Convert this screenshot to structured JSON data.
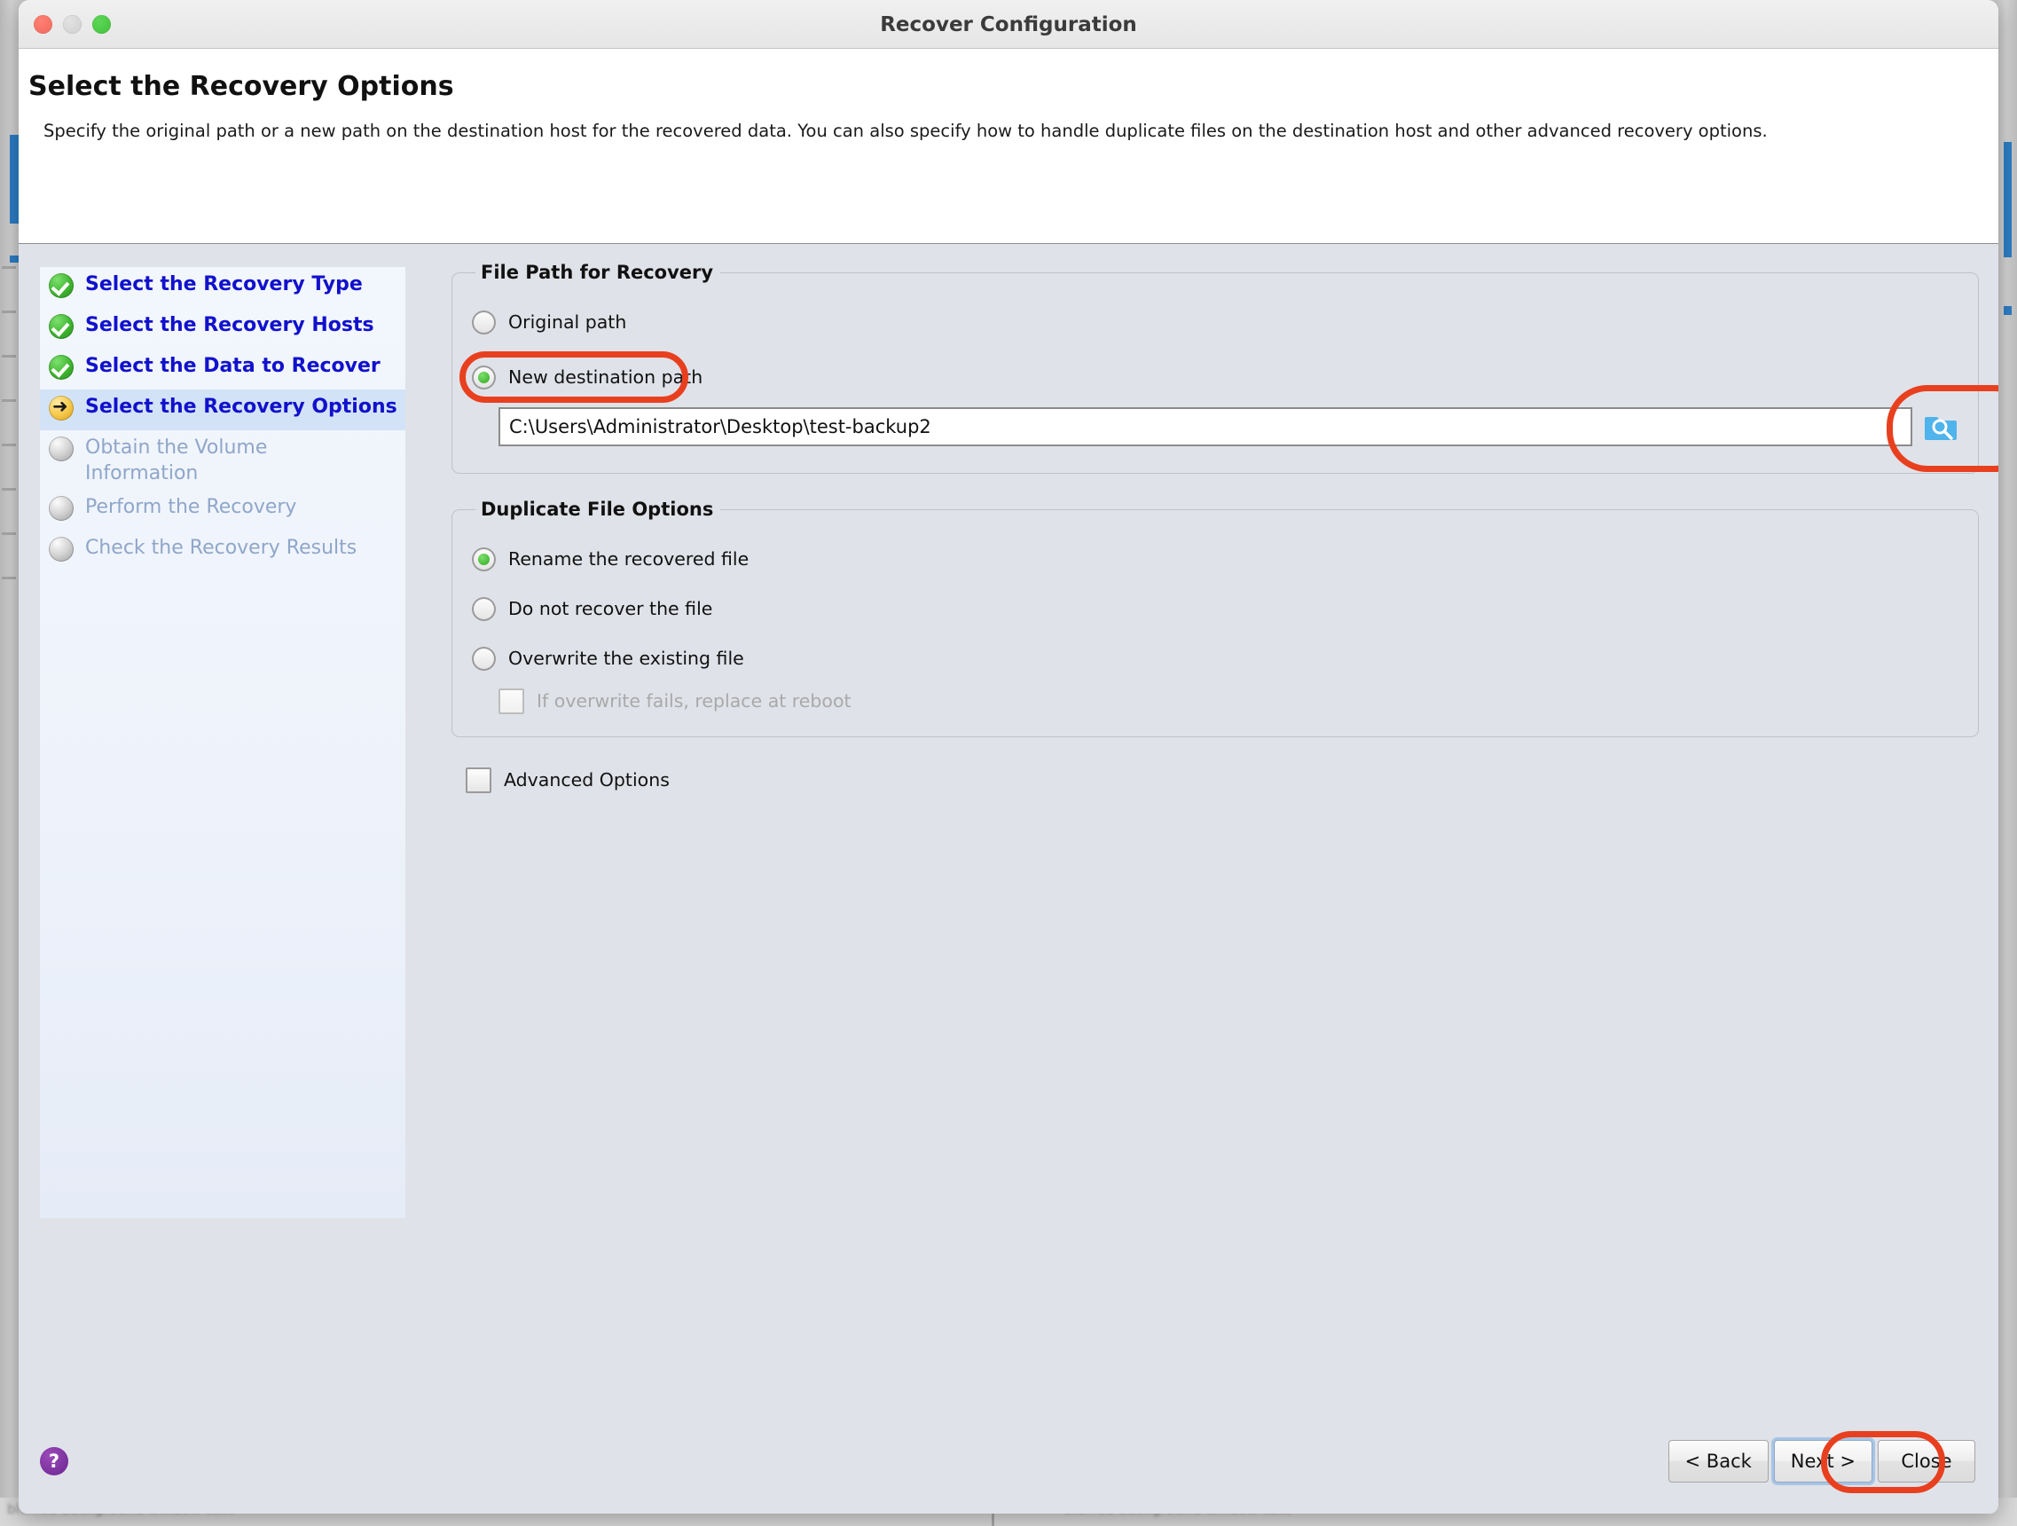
{
  "window": {
    "title": "Recover Configuration",
    "traffic_lights": [
      "close",
      "minimize",
      "maximize"
    ]
  },
  "header": {
    "page_title": "Select the Recovery Options",
    "description": "Specify the original path or a new path on the destination host for the recovered data. You can also specify how to handle duplicate files on the destination host and other advanced recovery options."
  },
  "sidebar": {
    "items": [
      {
        "label": "Select the Recovery Type",
        "state": "done"
      },
      {
        "label": "Select the Recovery Hosts",
        "state": "done"
      },
      {
        "label": "Select the Data to Recover",
        "state": "done"
      },
      {
        "label": "Select the Recovery Options",
        "state": "current"
      },
      {
        "label": "Obtain the Volume Information",
        "state": "pending"
      },
      {
        "label": "Perform the Recovery",
        "state": "pending"
      },
      {
        "label": "Check the Recovery Results",
        "state": "pending"
      }
    ]
  },
  "file_path_group": {
    "legend": "File Path for Recovery",
    "options": [
      {
        "label": "Original path",
        "checked": false
      },
      {
        "label": "New destination path",
        "checked": true
      }
    ],
    "path_value": "C:\\Users\\Administrator\\Desktop\\test-backup2",
    "path_placeholder": "",
    "browse_icon": "folder-search-icon"
  },
  "duplicate_group": {
    "legend": "Duplicate File Options",
    "options": [
      {
        "label": "Rename the recovered file",
        "checked": true
      },
      {
        "label": "Do not recover the file",
        "checked": false
      },
      {
        "label": "Overwrite the existing file",
        "checked": false
      }
    ],
    "sub_checkbox": {
      "label": "If overwrite fails, replace at reboot",
      "checked": false,
      "disabled": true
    }
  },
  "advanced": {
    "label": "Advanced Options",
    "checked": false
  },
  "footer": {
    "help_glyph": "?",
    "buttons": [
      {
        "label": "< Back",
        "default": false
      },
      {
        "label": "Next >",
        "default": true
      },
      {
        "label": "Close",
        "default": false
      }
    ]
  },
  "annotations": {
    "color": "#e8401f",
    "targets": [
      "new-destination-path-radio",
      "browse-button",
      "next-button"
    ]
  },
  "background": {
    "bottom_text_left": "blurred background window text",
    "bottom_text_right": "blurred background window text"
  }
}
